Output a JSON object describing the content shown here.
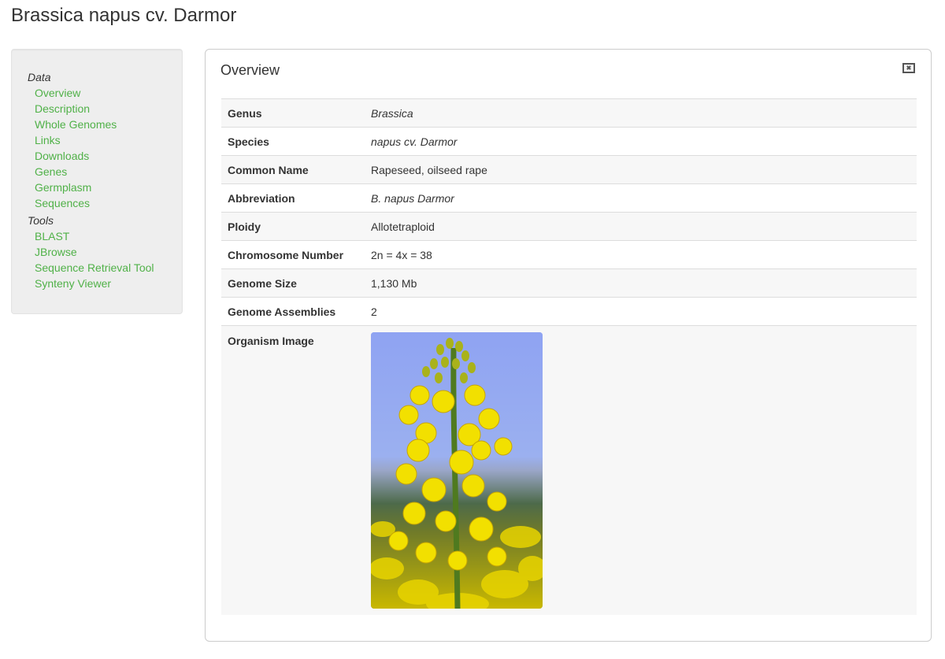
{
  "page": {
    "title": "Brassica napus cv. Darmor"
  },
  "sidebar": {
    "groups": [
      {
        "heading": "Data",
        "items": [
          {
            "label": "Overview"
          },
          {
            "label": "Description"
          },
          {
            "label": "Whole Genomes"
          },
          {
            "label": "Links"
          },
          {
            "label": "Downloads"
          },
          {
            "label": "Genes"
          },
          {
            "label": "Germplasm"
          },
          {
            "label": "Sequences"
          }
        ]
      },
      {
        "heading": "Tools",
        "items": [
          {
            "label": "BLAST"
          },
          {
            "label": "JBrowse"
          },
          {
            "label": "Sequence Retrieval Tool"
          },
          {
            "label": "Synteny Viewer"
          }
        ]
      }
    ],
    "link_color": "#50b148"
  },
  "panel": {
    "title": "Overview",
    "close_icon": "close-icon",
    "rows": [
      {
        "label": "Genus",
        "value": "Brassica"
      },
      {
        "label": "Species",
        "value": "napus cv. Darmor"
      },
      {
        "label": "Common Name",
        "value": "Rapeseed, oilseed rape"
      },
      {
        "label": "Abbreviation",
        "value": "B. napus Darmor"
      },
      {
        "label": "Ploidy",
        "value": "Allotetraploid"
      },
      {
        "label": "Chromosome Number",
        "value": "2n = 4x = 38"
      },
      {
        "label": "Genome Size",
        "value": "1,130 Mb"
      },
      {
        "label": "Genome Assemblies",
        "value": "2"
      },
      {
        "label": "Organism Image",
        "value": ""
      }
    ]
  }
}
